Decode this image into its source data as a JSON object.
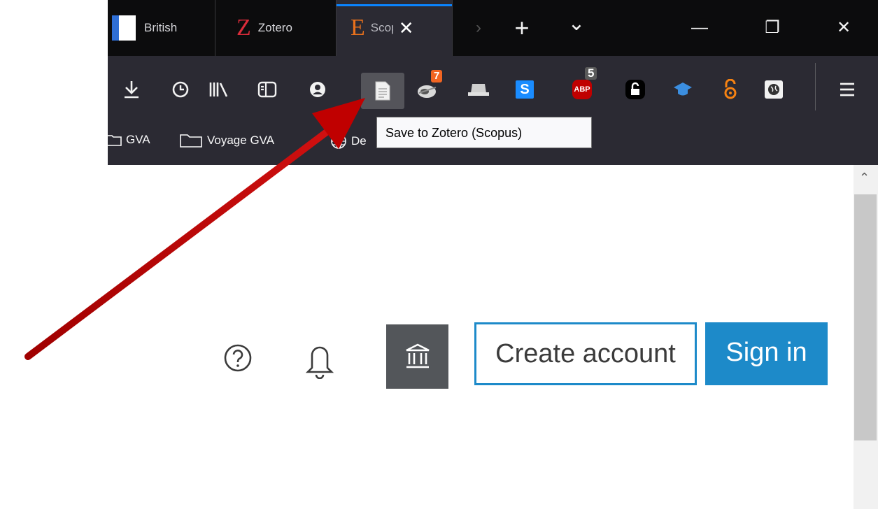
{
  "tabs": [
    {
      "label": "British"
    },
    {
      "label": "Zotero",
      "icon_letter": "Z"
    },
    {
      "label": "Scopus",
      "icon_letter": "E",
      "active": true
    }
  ],
  "tab_controls": {
    "new_tab": "+",
    "list_tabs": "⌄",
    "scroll": "›"
  },
  "window_controls": {
    "minimize": "—",
    "restore": "❐",
    "close": "✕"
  },
  "toolbar": {
    "badges": {
      "extension_count": "7",
      "abp_count": "5"
    },
    "abp_label": "ABP",
    "s_label": "S",
    "save_tooltip": "Save to Zotero (Scopus)"
  },
  "bookmarks": [
    {
      "label": "GVA"
    },
    {
      "label": "Voyage GVA"
    },
    {
      "label": "De"
    }
  ],
  "page": {
    "create_account": "Create account",
    "sign_in": "Sign in"
  },
  "colors": {
    "accent": "#1d8ac9",
    "arrow": "#c00000",
    "abp_red": "#c00000",
    "badge_orange": "#f26522"
  }
}
